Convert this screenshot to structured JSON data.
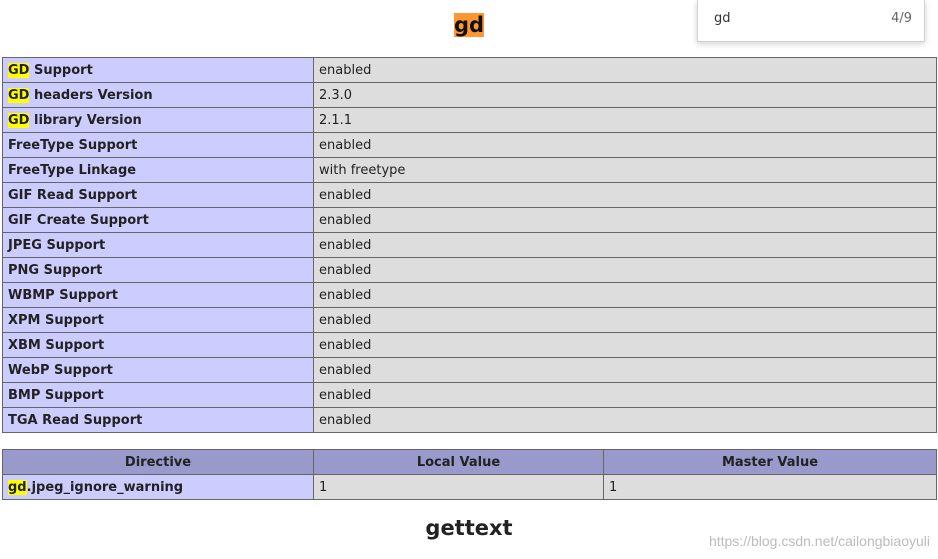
{
  "find_bar": {
    "query": "gd",
    "match_count": "4/9"
  },
  "sections": {
    "gd_title": "gd",
    "gettext_title": "gettext"
  },
  "features": [
    {
      "prefix": "GD",
      "label": " Support",
      "value": "enabled"
    },
    {
      "prefix": "GD",
      "label": " headers Version",
      "value": "2.3.0"
    },
    {
      "prefix": "GD",
      "label": " library Version",
      "value": "2.1.1"
    },
    {
      "prefix": "",
      "label": "FreeType Support",
      "value": "enabled"
    },
    {
      "prefix": "",
      "label": "FreeType Linkage",
      "value": "with freetype"
    },
    {
      "prefix": "",
      "label": "GIF Read Support",
      "value": "enabled"
    },
    {
      "prefix": "",
      "label": "GIF Create Support",
      "value": "enabled"
    },
    {
      "prefix": "",
      "label": "JPEG Support",
      "value": "enabled"
    },
    {
      "prefix": "",
      "label": "PNG Support",
      "value": "enabled"
    },
    {
      "prefix": "",
      "label": "WBMP Support",
      "value": "enabled"
    },
    {
      "prefix": "",
      "label": "XPM Support",
      "value": "enabled"
    },
    {
      "prefix": "",
      "label": "XBM Support",
      "value": "enabled"
    },
    {
      "prefix": "",
      "label": "WebP Support",
      "value": "enabled"
    },
    {
      "prefix": "",
      "label": "BMP Support",
      "value": "enabled"
    },
    {
      "prefix": "",
      "label": "TGA Read Support",
      "value": "enabled"
    }
  ],
  "directives": {
    "headers": [
      "Directive",
      "Local Value",
      "Master Value"
    ],
    "rows": [
      {
        "prefix": "gd",
        "name": ".jpeg_ignore_warning",
        "local": "1",
        "master": "1"
      }
    ]
  },
  "watermark": "https://blog.csdn.net/cailongbiaoyuli",
  "colors": {
    "row_label_bg": "#ccccff",
    "row_value_bg": "#dddddd",
    "header_bg": "#9999cc",
    "highlight": "#ffff00",
    "current_highlight": "#ff9632"
  }
}
